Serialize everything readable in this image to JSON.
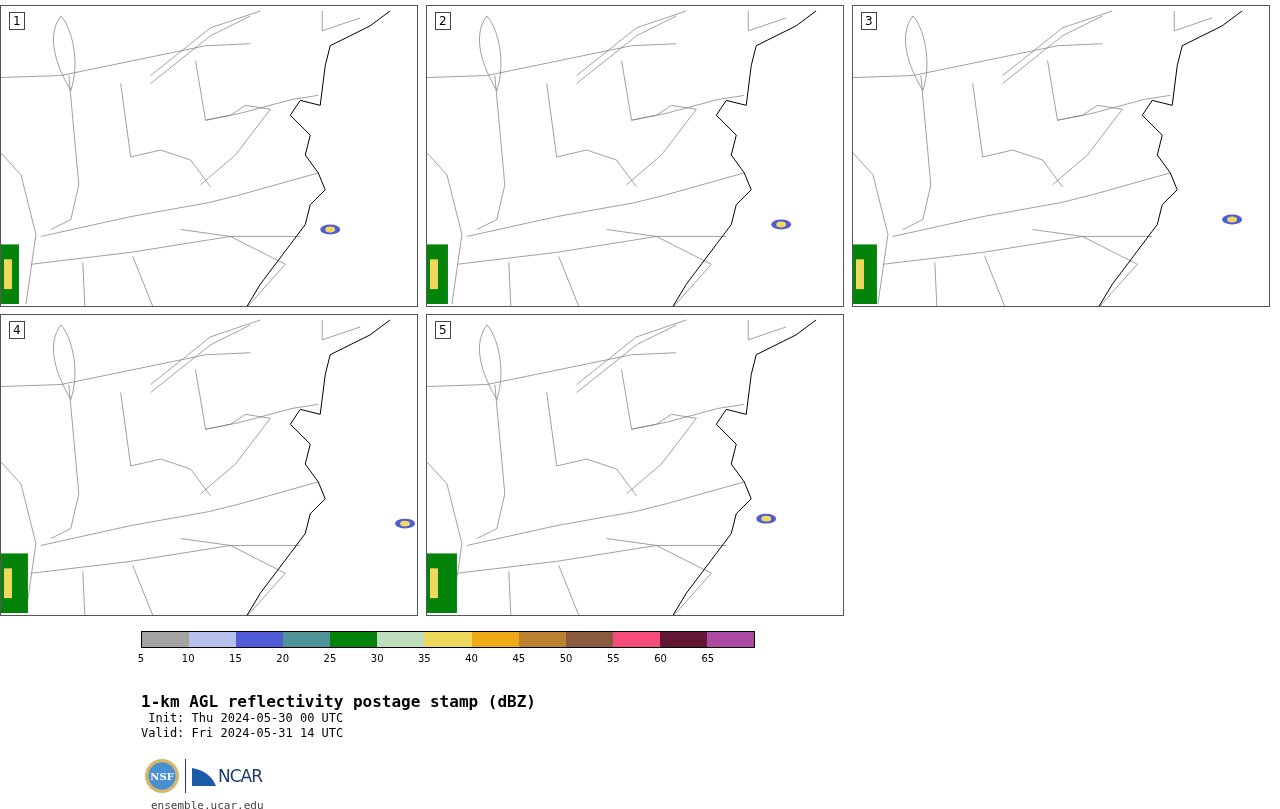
{
  "panels": [
    {
      "label": "1"
    },
    {
      "label": "2"
    },
    {
      "label": "3"
    },
    {
      "label": "4"
    },
    {
      "label": "5"
    }
  ],
  "colorbar": {
    "segments": [
      {
        "label": "5",
        "color": "#a3a3a3"
      },
      {
        "label": "10",
        "color": "#b6c0ed"
      },
      {
        "label": "15",
        "color": "#525bd6"
      },
      {
        "label": "20",
        "color": "#4f9499"
      },
      {
        "label": "25",
        "color": "#03830a"
      },
      {
        "label": "30",
        "color": "#bedebd"
      },
      {
        "label": "35",
        "color": "#efd95c"
      },
      {
        "label": "40",
        "color": "#efaa18"
      },
      {
        "label": "45",
        "color": "#bb8232"
      },
      {
        "label": "50",
        "color": "#8a5a3e"
      },
      {
        "label": "55",
        "color": "#f54c7b"
      },
      {
        "label": "60",
        "color": "#621734"
      },
      {
        "label": "65",
        "color": "#ab4aa2"
      }
    ]
  },
  "title": "1-km AGL reflectivity postage stamp (dBZ)",
  "init": " Init: Thu 2024-05-30 00 UTC",
  "valid": "Valid: Fri 2024-05-31 14 UTC",
  "logo": {
    "left": "NSF",
    "right": "NCAR"
  },
  "footer": "ensemble.ucar.edu"
}
